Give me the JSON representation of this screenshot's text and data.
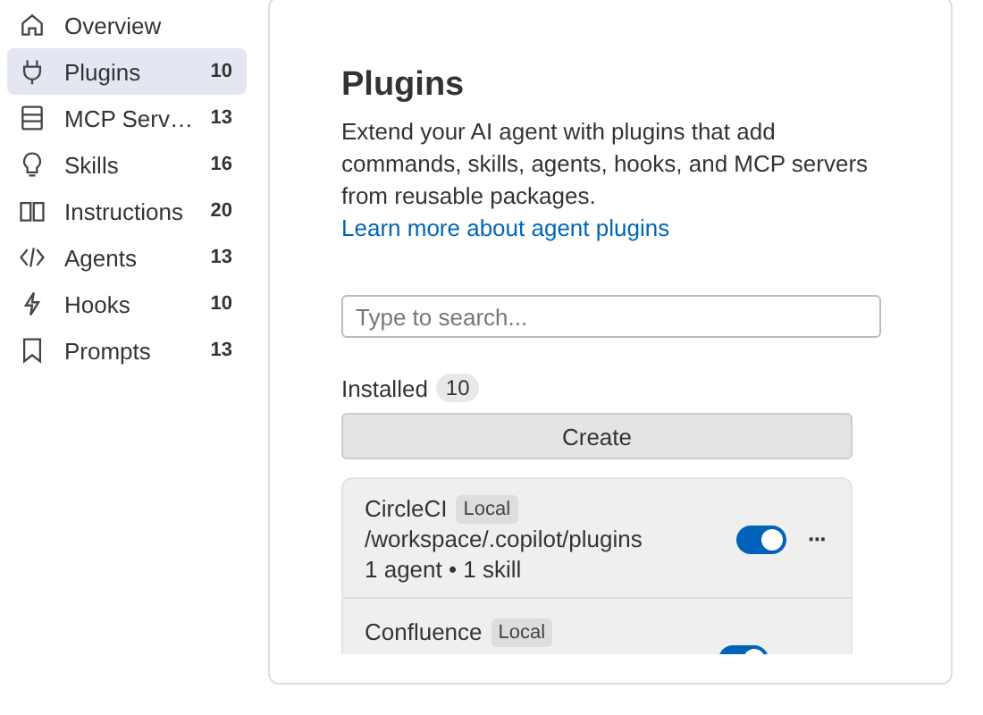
{
  "sidebar": {
    "items": [
      {
        "label": "Overview",
        "selected": false
      },
      {
        "label": "Plugins",
        "count": "10",
        "selected": true
      },
      {
        "label": "MCP Serv…",
        "count": "13",
        "selected": false
      },
      {
        "label": "Skills",
        "count": "16",
        "selected": false
      },
      {
        "label": "Instructions",
        "count": "20",
        "selected": false
      },
      {
        "label": "Agents",
        "count": "13",
        "selected": false
      },
      {
        "label": "Hooks",
        "count": "10",
        "selected": false
      },
      {
        "label": "Prompts",
        "count": "13",
        "selected": false
      }
    ]
  },
  "main": {
    "title": "Plugins",
    "description": "Extend your AI agent with plugins that add commands, skills, agents, hooks, and MCP servers from reusable packages.",
    "link": "Learn more about agent plugins",
    "search": {
      "placeholder": "Type to search..."
    },
    "installed_label": "Installed",
    "installed_count": "10",
    "create_button": "Create",
    "plugins": [
      {
        "name": "CircleCI",
        "badge": "Local",
        "path": "/workspace/.copilot/plugins",
        "summary": "1 agent • 1 skill",
        "on": true,
        "menu": "···"
      },
      {
        "name": "Confluence",
        "badge": "Local",
        "on": true
      }
    ]
  }
}
